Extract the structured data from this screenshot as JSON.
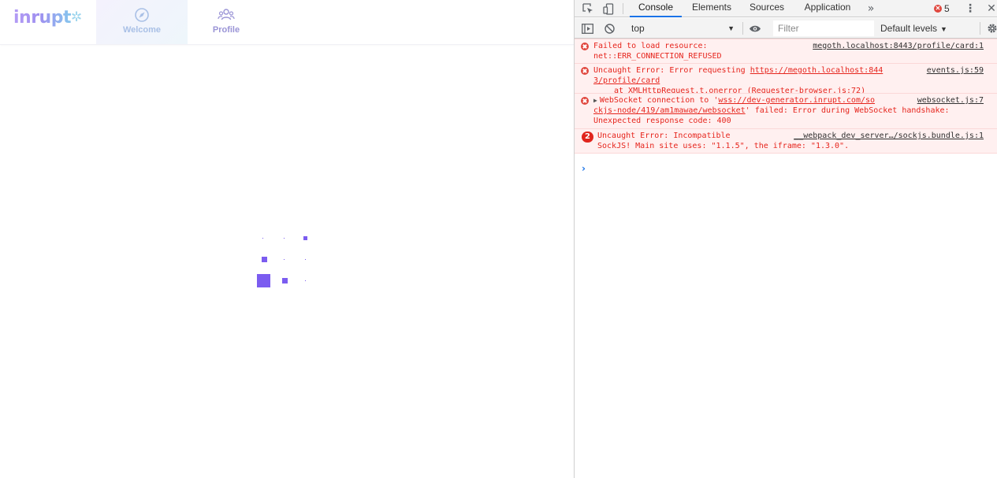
{
  "app": {
    "logo": "inrupt",
    "nav": [
      {
        "label": "Welcome",
        "icon": "compass-icon",
        "active": true
      },
      {
        "label": "Profile",
        "icon": "people-icon",
        "active": false
      }
    ],
    "loader_icon": "loading-squares-icon"
  },
  "devtools": {
    "tabs": [
      "Console",
      "Elements",
      "Sources",
      "Application"
    ],
    "active_tab": "Console",
    "more_tabs_icon": "chevron-double-right-icon",
    "error_count": "5",
    "context": "top",
    "filter_placeholder": "Filter",
    "levels_label": "Default levels",
    "messages": [
      {
        "text": "Failed to load resource: net::ERR_CONNECTION_REFUSED",
        "line1": "Failed to load resource:",
        "line2": "net::ERR_CONNECTION_REFUSED",
        "source": "megoth.localhost:8443/profile/card:1"
      },
      {
        "line1_prefix": "Uncaught Error: Error requesting ",
        "line1_link": "https://megoth.localhost:844",
        "line2_link": "3/profile/card",
        "line3_prefix": "at XMLHttpRequest.t.onerror (",
        "line3_link": "Requester-browser.js:72",
        "line3_suffix": ")",
        "source": "events.js:59"
      },
      {
        "line1_prefix": "WebSocket connection to '",
        "line1_link": "wss://dev-generator.inrupt.com/so",
        "line2_link": "ckjs-node/419/am1mawae/websocket",
        "line2_suffix": "' failed: Error during WebSocket handshake:",
        "line3": "Unexpected response code: 400",
        "source": "websocket.js:7"
      },
      {
        "count": "2",
        "line1": "Uncaught Error: Incompatible",
        "line2": "SockJS! Main site uses: \"1.1.5\", the iframe: \"1.3.0\".",
        "source": "__webpack_dev_server…/sockjs.bundle.js:1"
      }
    ],
    "prompt_symbol": "›"
  },
  "colors": {
    "brand_purple": "#7b5cf0",
    "error_red": "#e6251d",
    "error_bg": "#fff0f0",
    "devtools_blue": "#1a73e8"
  }
}
